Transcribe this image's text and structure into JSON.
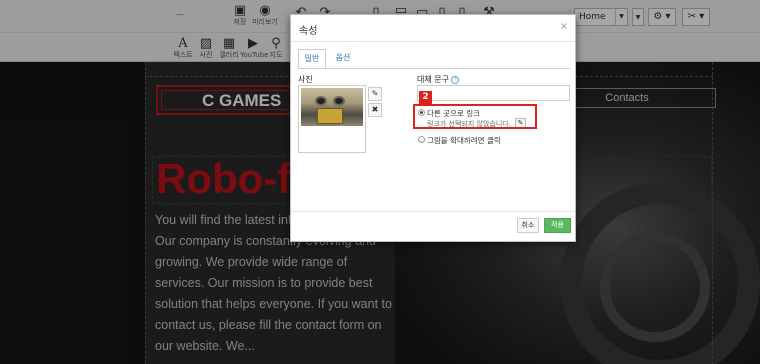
{
  "toolbar": {
    "save_label": "저장",
    "preview_label": "미리보기",
    "text_label": "텍스트",
    "photo_label": "사진",
    "gallery_label": "갤러리",
    "youtube_label": "YouTube",
    "map_label": "지도",
    "home_select": "Home"
  },
  "site": {
    "logo": "C GAMES",
    "contacts": "Contacts",
    "title": "Robo-f",
    "body": "You will find the latest inf... us on this page. Our company is constantly evolving and growing. We provide wide range of services. Our mission is to provide best solution that helps everyone. If you want to contact us, please fill the contact form on our website. We..."
  },
  "dialog": {
    "title": "속성",
    "close": "×",
    "tabs": [
      "일반",
      "옵션"
    ],
    "photo_label": "사진",
    "alt_label": "대체 문구",
    "link_option": "다른 곳으로 링크",
    "link_status": "링크가 선택되지 않았습니다.",
    "zoom_option": "그림을 확대하려면 클릭",
    "cancel": "취소",
    "apply": "적용",
    "step_badge": "2"
  },
  "colors": {
    "accent_green": "#5cb85c",
    "highlight_red": "#e0201e",
    "title_red": "#c0131a"
  }
}
